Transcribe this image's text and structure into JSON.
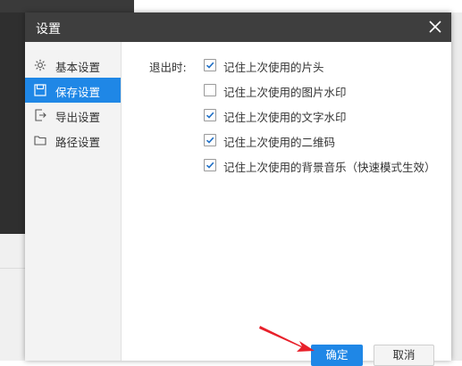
{
  "dialog": {
    "title": "设置",
    "close_icon": "close-icon"
  },
  "sidebar": {
    "items": [
      {
        "label": "基本设置",
        "icon": "gear-icon",
        "active": false
      },
      {
        "label": "保存设置",
        "icon": "save-icon",
        "active": true
      },
      {
        "label": "导出设置",
        "icon": "export-icon",
        "active": false
      },
      {
        "label": "路径设置",
        "icon": "folder-icon",
        "active": false
      }
    ]
  },
  "content": {
    "exit_label": "退出时:",
    "options": [
      {
        "label": "记住上次使用的片头",
        "checked": true
      },
      {
        "label": "记住上次使用的图片水印",
        "checked": false
      },
      {
        "label": "记住上次使用的文字水印",
        "checked": true
      },
      {
        "label": "记住上次使用的二维码",
        "checked": true
      },
      {
        "label": "记住上次使用的背景音乐（快速模式生效）",
        "checked": true
      }
    ]
  },
  "footer": {
    "ok_label": "确定",
    "cancel_label": "取消"
  },
  "colors": {
    "accent": "#1f87e6",
    "titlebar": "#3e3e3e",
    "annotation_arrow": "#e8202a"
  }
}
